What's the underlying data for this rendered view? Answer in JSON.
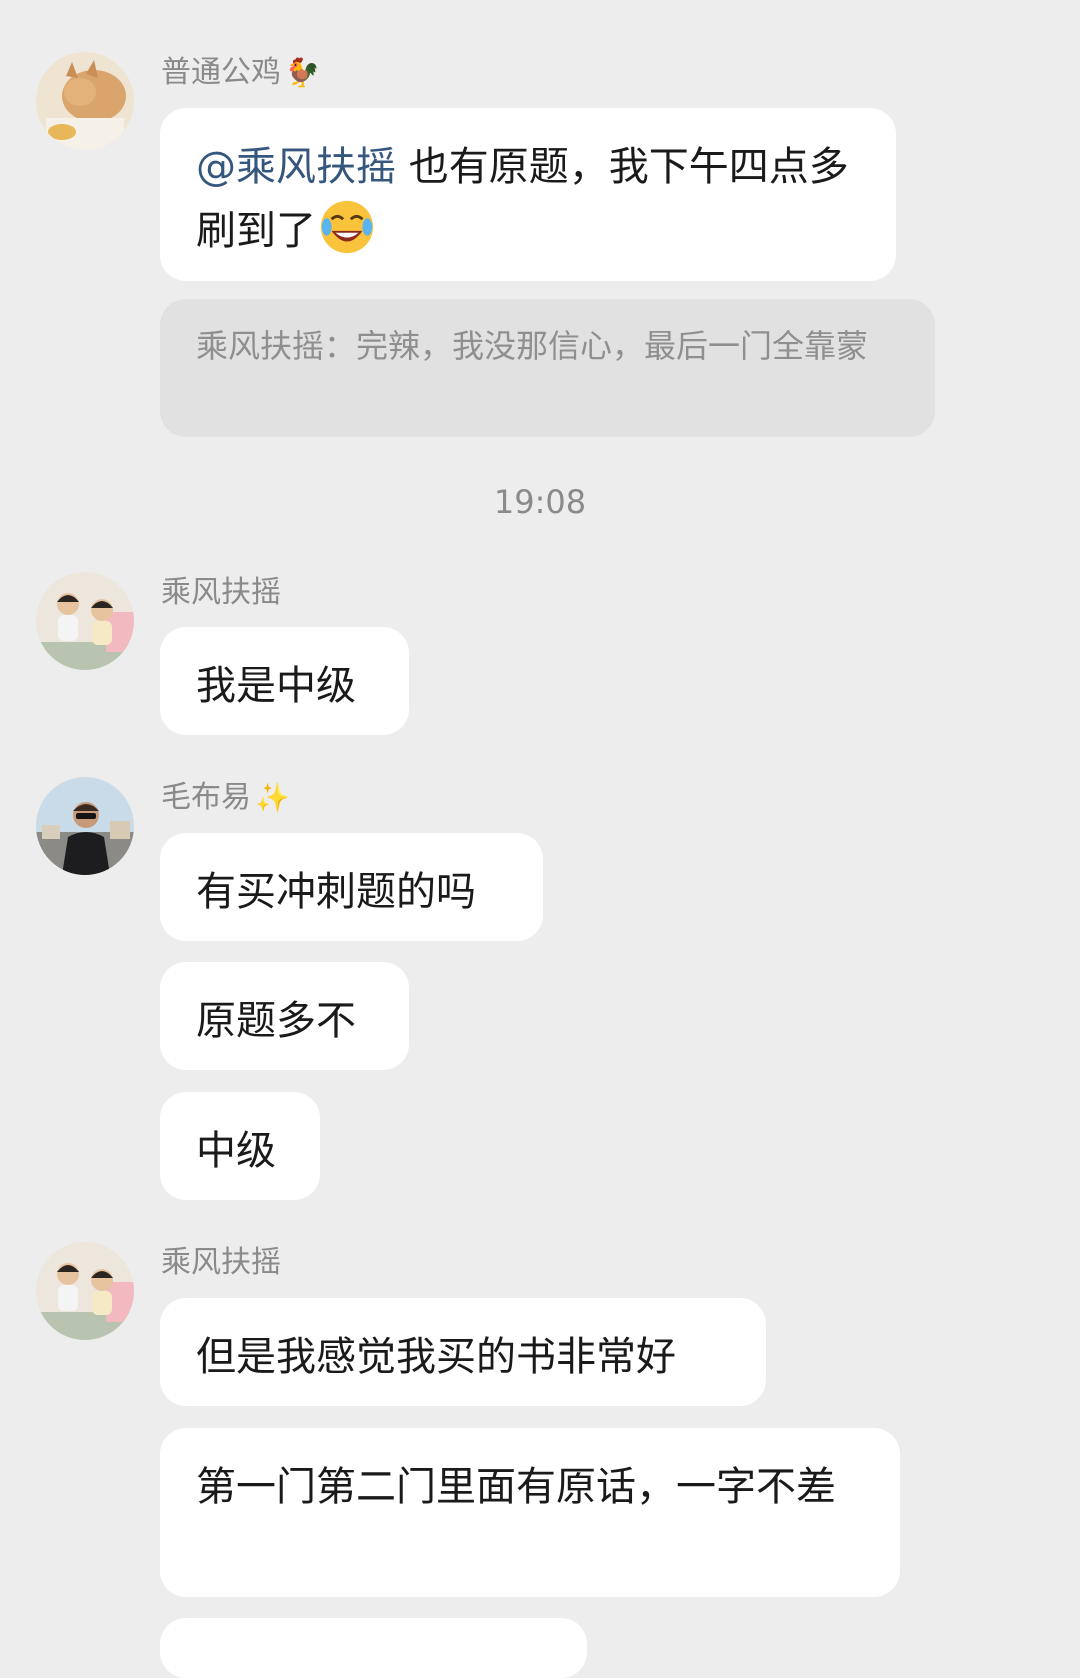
{
  "messages": [
    {
      "sender": "普通公鸡",
      "sender_emoji": "🐓",
      "mention": "@乘风扶摇",
      "text": "也有原题，我下午四点多刷到了",
      "emoji_icon": "rolling-on-floor-laughing-icon",
      "quote": "乘风扶摇：完辣，我没那信心，最后一门全靠蒙"
    },
    {
      "sender": "乘风扶摇",
      "bubbles": [
        "我是中级"
      ]
    },
    {
      "sender": "毛布易",
      "sender_emoji": "✨",
      "bubbles": [
        "有买冲刺题的吗",
        "原题多不",
        "中级"
      ]
    },
    {
      "sender": "乘风扶摇",
      "bubbles": [
        "但是我感觉我买的书非常好",
        "第一门第二门里面有原话，一字不差"
      ]
    }
  ],
  "timestamp": "19:08",
  "colors": {
    "background": "#ededed",
    "bubble": "#ffffff",
    "quote_background": "#e1e1e1",
    "mention": "#35577e"
  }
}
